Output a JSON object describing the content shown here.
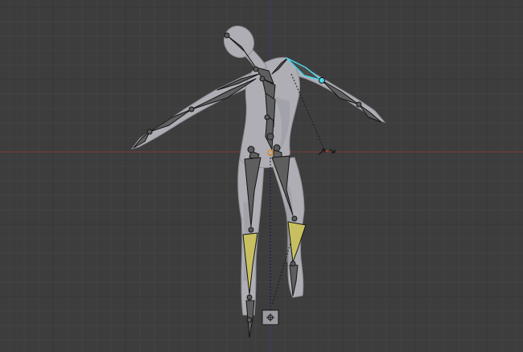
{
  "viewport": {
    "kind": "3d-viewport",
    "mode": "pose-mode",
    "grid_visible": true
  },
  "scene": {
    "mesh": {
      "name": "humanoid-character",
      "color": "#aeaeb4"
    },
    "armature": {
      "display": "octahedral",
      "bone_color": "#5e5e5e",
      "bone_edge_color": "#141414",
      "selected_bone": "upper-arm-left",
      "selected_color": "#4fd8ea",
      "ik_bone_color": "#c8c060"
    }
  },
  "colors": {
    "background": "#3d3d3d",
    "grid_minor": "#444444",
    "grid_major": "#363636",
    "axis_x": "#7a3b3b",
    "axis_z": "#3c3c7e",
    "ik_line": "#1a1a1a",
    "transform_widget": "#1c1c1c"
  },
  "icons": {
    "ik_target": "ik-target-icon",
    "transform_widget": "rotate-widget-icon"
  }
}
